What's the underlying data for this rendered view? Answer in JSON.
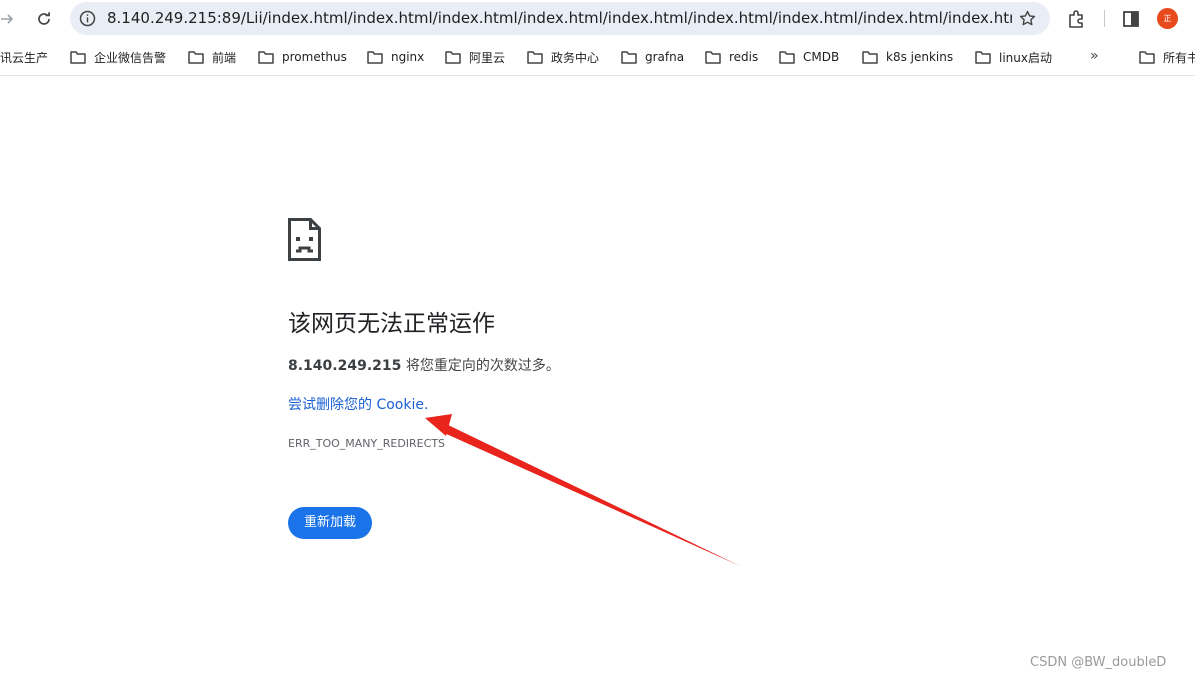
{
  "toolbar": {
    "url": "8.140.249.215:89/Lii/index.html/index.html/index.html/index.html/index.html/index.html/index.html/index.html/index.html/index.html/index.htm...",
    "profile_initial": "正"
  },
  "bookmarks": {
    "items": [
      {
        "label": "讯云生产"
      },
      {
        "label": "企业微信告警"
      },
      {
        "label": "前端"
      },
      {
        "label": "promethus"
      },
      {
        "label": "nginx"
      },
      {
        "label": "阿里云"
      },
      {
        "label": "政务中心"
      },
      {
        "label": "grafna"
      },
      {
        "label": "redis"
      },
      {
        "label": "CMDB"
      },
      {
        "label": "k8s jenkins"
      },
      {
        "label": "linux启动"
      },
      {
        "label": "所有书"
      }
    ],
    "overflow_label": "»"
  },
  "error": {
    "title": "该网页无法正常运作",
    "host": "8.140.249.215",
    "message": " 将您重定向的次数过多。",
    "link": "尝试删除您的 Cookie.",
    "code": "ERR_TOO_MANY_REDIRECTS",
    "reload_label": "重新加载"
  },
  "annotation": {
    "arrow_color": "#e8241c"
  },
  "watermark": "CSDN @BW_doubleD",
  "colors": {
    "accent": "#1a73e8",
    "link": "#1a5fd4",
    "omnibox": "#e9eef6"
  }
}
